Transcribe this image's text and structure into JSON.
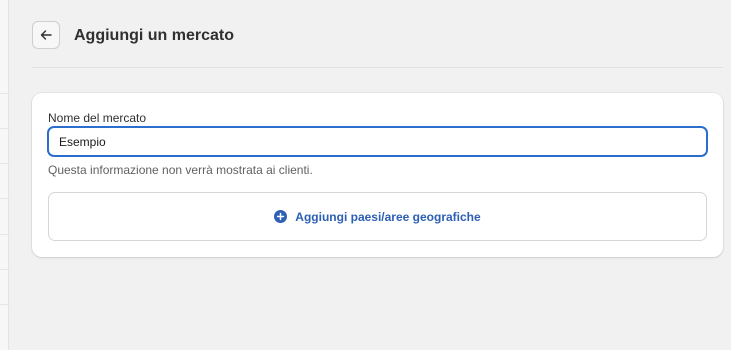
{
  "header": {
    "title": "Aggiungi un mercato",
    "back_icon": "arrow-left-icon"
  },
  "form": {
    "market_name_label": "Nome del mercato",
    "market_name_value": "Esempio",
    "market_name_help": "Questa informazione non verrà mostrata ai clienti.",
    "add_regions_label": "Aggiungi paesi/aree geografiche",
    "add_regions_icon": "plus-circle-icon"
  },
  "colors": {
    "accent": "#2c6ecb",
    "link": "#2c5fb5",
    "background": "#f1f1f1",
    "card": "#ffffff"
  }
}
